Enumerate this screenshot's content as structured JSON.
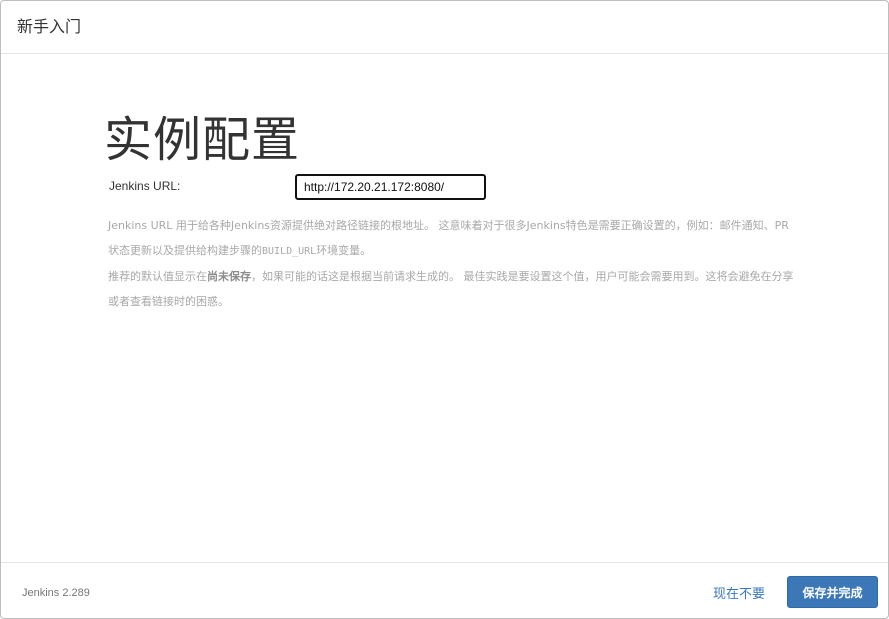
{
  "header": {
    "title": "新手入门"
  },
  "main": {
    "title": "实例配置",
    "url_label": "Jenkins URL:",
    "url_value": "http://172.20.21.172:8080/",
    "help": {
      "p1_a": "Jenkins URL 用于给各种Jenkins资源提供绝对路径链接的根地址。 这意味着对于很多Jenkins特色是需要正确设置的，例如：邮件通知、PR状态更新以及提供给构建步骤的",
      "p1_code": "BUILD_URL",
      "p1_b": "环境变量。",
      "p2_a": "推荐的默认值显示在",
      "p2_strong": "尚未保存",
      "p2_b": "，如果可能的话这是根据当前请求生成的。 最佳实践是要设置这个值，用户可能会需要用到。这将会避免在分享或者查看链接时的困惑。"
    }
  },
  "footer": {
    "version": "Jenkins 2.289",
    "skip_label": "现在不要",
    "save_label": "保存并完成"
  },
  "colors": {
    "primary": "#3c78b8",
    "link": "#3a77b9",
    "help_text": "#a8a8a8"
  }
}
